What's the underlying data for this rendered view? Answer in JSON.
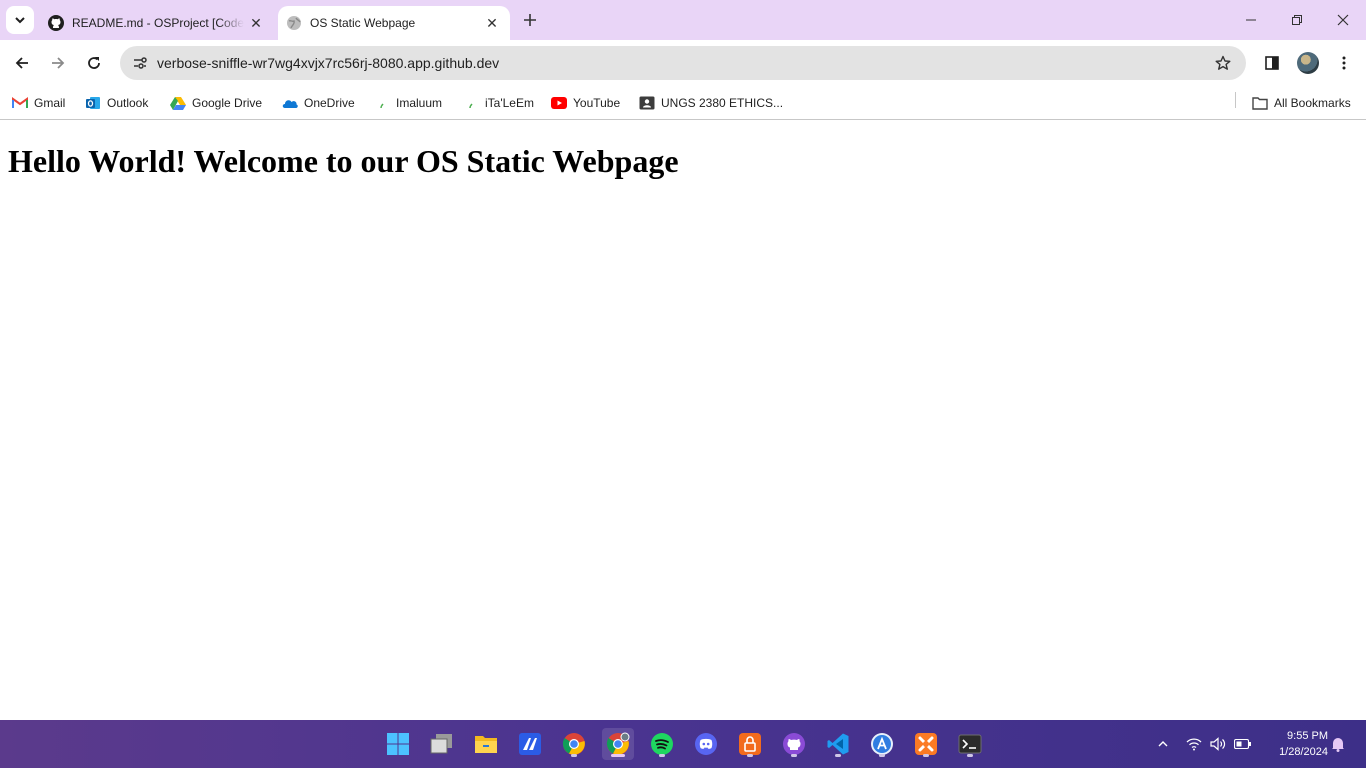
{
  "tabs": [
    {
      "title": "README.md - OSProject [Codespaces: verbose sniffle]",
      "active": false,
      "icon": "github-icon"
    },
    {
      "title": "OS Static Webpage",
      "active": true,
      "icon": "globe-icon"
    }
  ],
  "address_bar": {
    "url": "verbose-sniffle-wr7wg4xvjx7rc56rj-8080.app.github.dev"
  },
  "bookmarks": [
    {
      "label": "Gmail",
      "icon": "gmail-icon"
    },
    {
      "label": "Outlook",
      "icon": "outlook-icon"
    },
    {
      "label": "Google Drive",
      "icon": "google-drive-icon"
    },
    {
      "label": "OneDrive",
      "icon": "onedrive-icon"
    },
    {
      "label": "Imaluum",
      "icon": "leaf-icon"
    },
    {
      "label": "iTa'LeEm",
      "icon": "leaf-icon"
    },
    {
      "label": "YouTube",
      "icon": "youtube-icon"
    },
    {
      "label": "UNGS 2380 ETHICS...",
      "icon": "contact-card-icon"
    }
  ],
  "all_bookmarks_label": "All Bookmarks",
  "page": {
    "heading": "Hello World! Welcome to our OS Static Webpage"
  },
  "taskbar": {
    "apps": [
      "windows-start-icon",
      "task-view-icon",
      "file-explorer-icon",
      "ai-app-icon",
      "chrome-icon",
      "chrome-profile-icon",
      "spotify-icon",
      "discord-icon",
      "vpn-icon",
      "github-desktop-icon",
      "vscode-icon",
      "app-store-icon",
      "xampp-icon",
      "terminal-icon"
    ],
    "clock": {
      "time": "9:55 PM",
      "date": "1/28/2024"
    }
  },
  "colors": {
    "tabstrip": "#e9d5f7",
    "omnibox": "#e3e3e3",
    "taskbar": "#4a3490"
  }
}
